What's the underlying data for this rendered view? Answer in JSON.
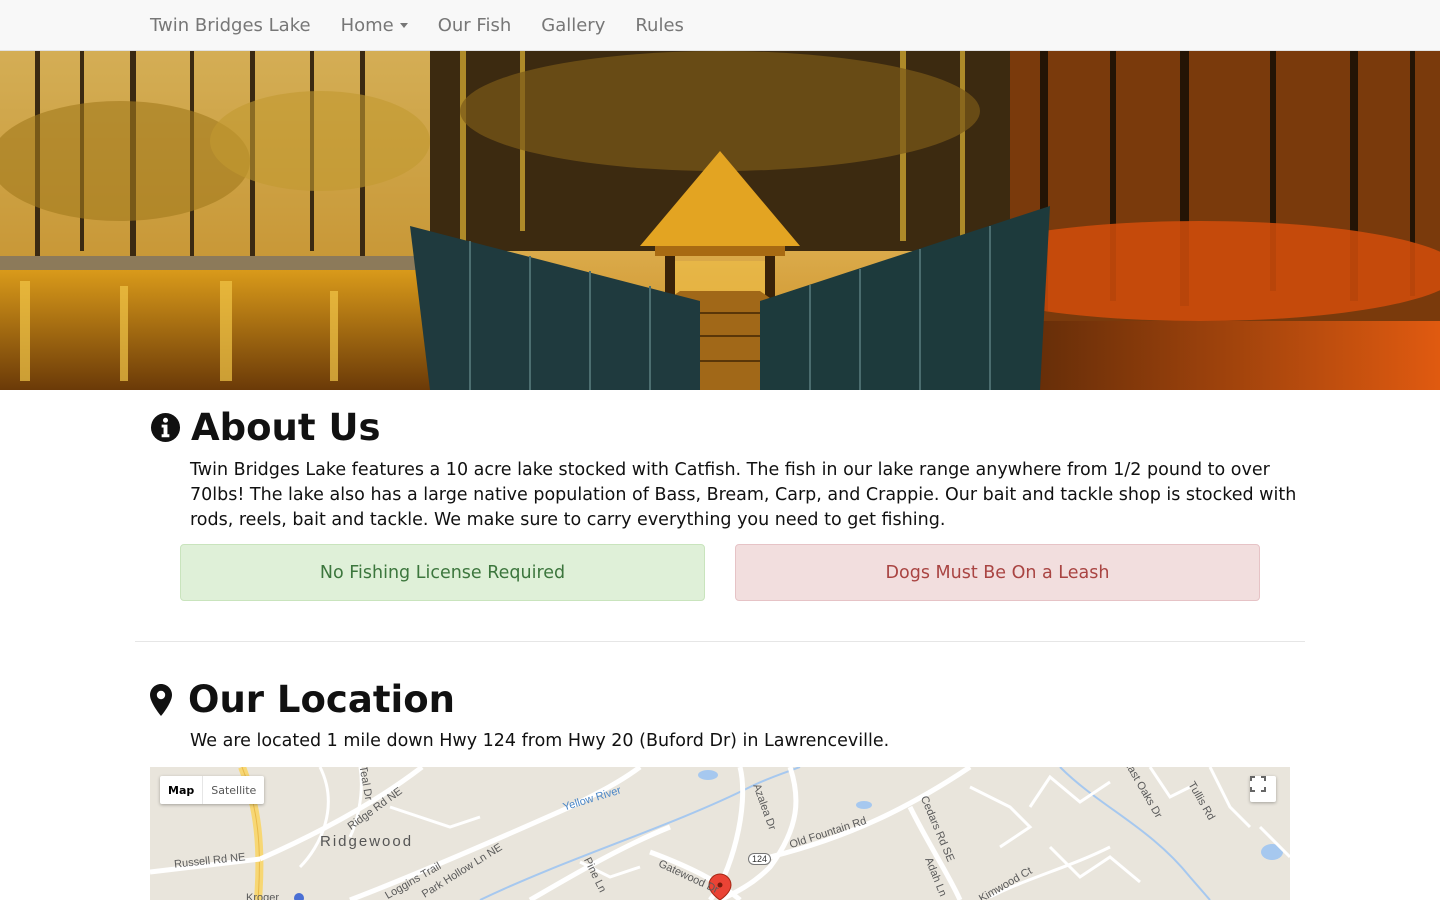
{
  "navbar": {
    "brand": "Twin Bridges Lake",
    "items": [
      {
        "label": "Home",
        "has_dropdown": true
      },
      {
        "label": "Our Fish"
      },
      {
        "label": "Gallery"
      },
      {
        "label": "Rules"
      }
    ]
  },
  "about": {
    "title": "About Us",
    "icon": "info-circle-icon",
    "text": "Twin Bridges Lake features a 10 acre lake stocked with Catfish. The fish in our lake range anywhere from 1/2 pound to over 70lbs! The lake also has a large native population of Bass, Bream, Carp, and Crappie. Our bait and tackle shop is stocked with rods, reels, bait and tackle. We make sure to carry everything you need to get fishing.",
    "alerts": {
      "success": "No Fishing License Required",
      "danger": "Dogs Must Be On a Leash"
    }
  },
  "location": {
    "title": "Our Location",
    "icon": "map-marker-icon",
    "text": "We are located 1 mile down Hwy 124 from Hwy 20 (Buford Dr) in Lawrenceville."
  },
  "map": {
    "type_buttons": [
      "Map",
      "Satellite"
    ],
    "active_type": "Map",
    "labels": {
      "ridgewood": "Ridgewood",
      "yellow_river": "Yellow River",
      "azalea_dr": "Azalea Dr",
      "old_fountain_rd": "Old Fountain Rd",
      "cedars_rd_se": "Cedars Rd SE",
      "adah_ln": "Adah Ln",
      "kimwood_ct": "Kimwood Ct",
      "tullis_rd": "Tullis Rd",
      "east_oaks_dr": "East Oaks Dr",
      "ridge_rd_ne": "Ridge Rd NE",
      "russell_rd_ne": "Russell Rd NE",
      "loggins_trail": "Loggins Trail",
      "park_hollow_ln_ne": "Park Hollow Ln NE",
      "pine_ln": "Pine Ln",
      "gatewood_dr": "Gatewood Dr",
      "teal_dr": "Teal Dr",
      "hwy_shield": "124",
      "kroger": "Kroger"
    }
  },
  "colors": {
    "success_bg": "#dff0d8",
    "success_text": "#3c763d",
    "danger_bg": "#f2dede",
    "danger_text": "#a94442",
    "nav_bg": "#f8f8f8"
  }
}
